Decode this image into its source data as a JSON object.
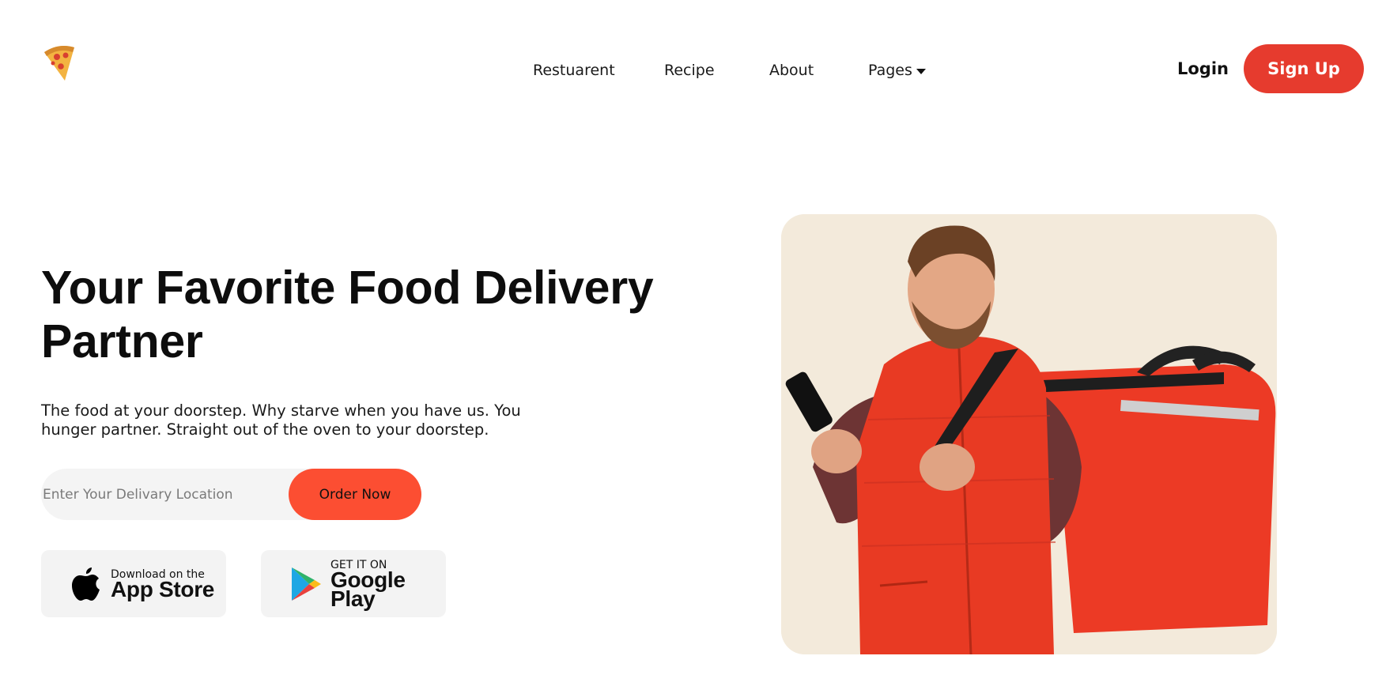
{
  "brand": {
    "logo_icon": "pizza-slice-icon"
  },
  "nav": {
    "items": [
      {
        "label": "Restuarent"
      },
      {
        "label": "Recipe"
      },
      {
        "label": "About"
      },
      {
        "label": "Pages"
      }
    ]
  },
  "auth": {
    "login_label": "Login",
    "signup_label": "Sign Up"
  },
  "hero": {
    "title": "Your Favorite Food Delivery Partner",
    "subtitle": "The food at your doorstep. Why starve when you have us. You hunger partner. Straight out of the oven to your doorstep.",
    "search": {
      "placeholder": "Enter Your Delivary Location",
      "value": ""
    },
    "order_label": "Order Now",
    "image_icon": "delivery-man-photo"
  },
  "stores": {
    "apple": {
      "small": "Download on the",
      "big": "App Store",
      "icon": "apple-icon"
    },
    "google": {
      "small": "GET IT ON",
      "big": "Google Play",
      "icon": "google-play-icon"
    }
  },
  "colors": {
    "accent": "#e63b2e",
    "order": "#fc4e32",
    "card_bg": "#f3eadb",
    "field_bg": "#f4f4f4"
  }
}
